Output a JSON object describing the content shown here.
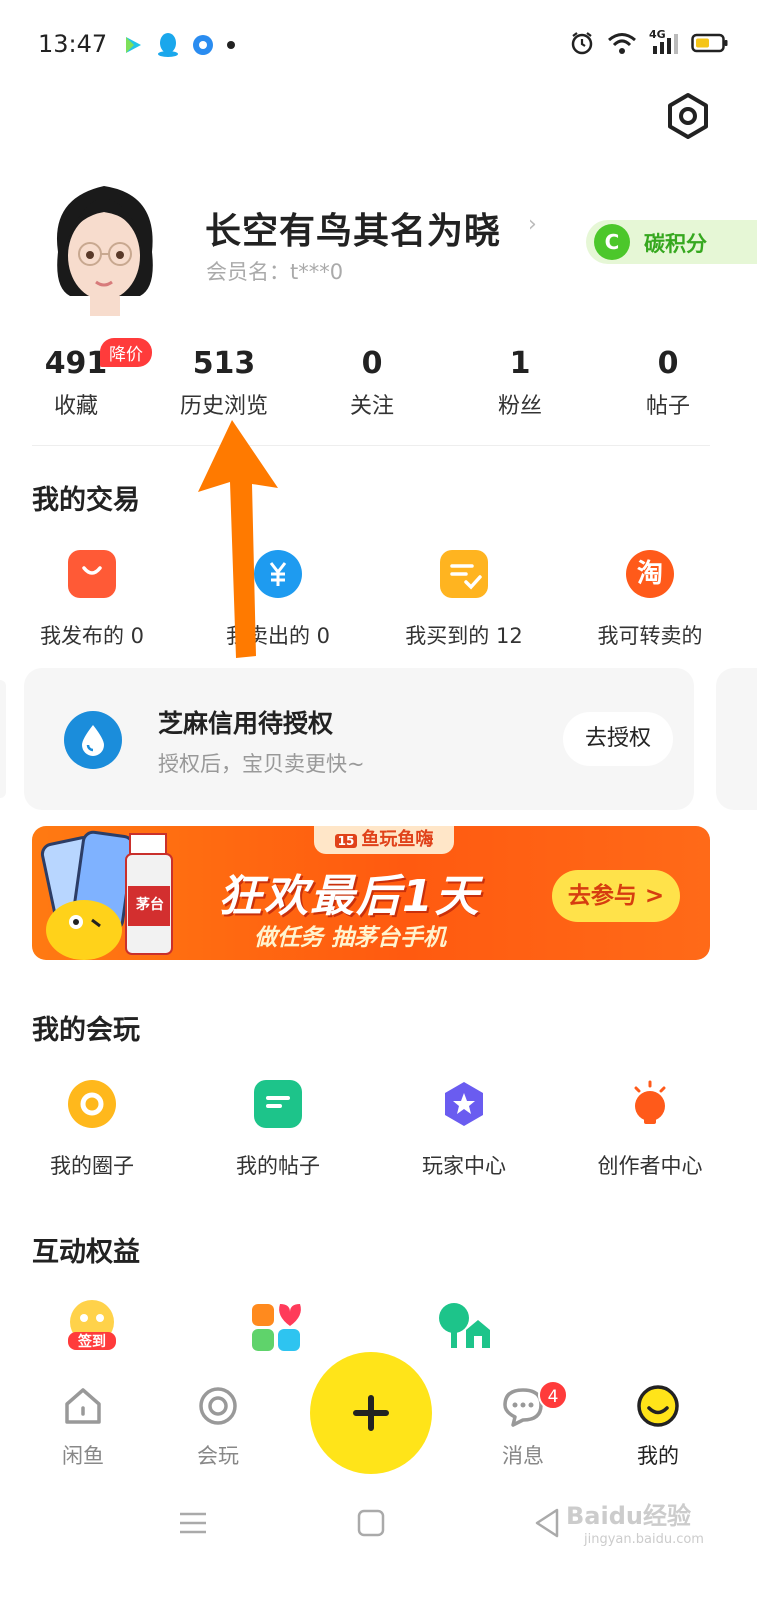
{
  "status_bar": {
    "time": "13:47",
    "network": "4G",
    "icons": [
      "video-app-icon",
      "qq-icon",
      "browser-icon",
      "dot-icon",
      "alarm-icon",
      "wifi-icon",
      "signal-icon",
      "battery-icon"
    ]
  },
  "profile": {
    "nickname": "长空有鸟其名为晓",
    "member_name": "会员名：t***0",
    "carbon_badge_letter": "C",
    "carbon_badge_label": "碳积分"
  },
  "stats": [
    {
      "value": "491",
      "label": "收藏",
      "badge": "降价"
    },
    {
      "value": "513",
      "label": "历史浏览"
    },
    {
      "value": "0",
      "label": "关注"
    },
    {
      "value": "1",
      "label": "粉丝"
    },
    {
      "value": "0",
      "label": "帖子"
    }
  ],
  "trade": {
    "title": "我的交易",
    "items": [
      {
        "label": "我发布的 0",
        "icon": "shopping-bag-icon",
        "color": "#ff5a36"
      },
      {
        "label": "我卖出的 0",
        "icon": "yuan-icon",
        "color": "#1e9bf0"
      },
      {
        "label": "我买到的 12",
        "icon": "order-check-icon",
        "color": "#ffb420"
      },
      {
        "label": "我可转卖的",
        "icon": "taobao-icon",
        "color": "#ff5a1a"
      }
    ]
  },
  "sesame": {
    "title": "芝麻信用待授权",
    "subtitle": "授权后，宝贝卖更快~",
    "button": "去授权"
  },
  "banner": {
    "tag": "鱼玩鱼嗨",
    "tag_num": "15",
    "title": "狂欢最后1天",
    "subtitle": "做任务 抽茅台手机",
    "button": "去参与 >",
    "bottle_text": "茅台"
  },
  "play": {
    "title": "我的会玩",
    "items": [
      {
        "label": "我的圈子",
        "icon": "circle-icon",
        "color": "#ffb81c"
      },
      {
        "label": "我的帖子",
        "icon": "post-icon",
        "color": "#1dc48a"
      },
      {
        "label": "玩家中心",
        "icon": "star-badge-icon",
        "color": "#6a5cf0"
      },
      {
        "label": "创作者中心",
        "icon": "bulb-icon",
        "color": "#ff5a1a"
      }
    ]
  },
  "rights": {
    "title": "互动权益",
    "checkin_label": "签到",
    "icons": [
      "checkin-icon",
      "puzzle-icon",
      "tree-house-icon"
    ]
  },
  "bottom_nav": {
    "items": [
      {
        "label": "闲鱼",
        "icon": "home-icon"
      },
      {
        "label": "会玩",
        "icon": "ring-icon"
      },
      {
        "label": "消息",
        "icon": "chat-icon",
        "badge": "4"
      },
      {
        "label": "我的",
        "icon": "smile-icon",
        "active": true
      }
    ],
    "publish_icon": "plus-icon"
  },
  "watermark": {
    "text": "Baidu经验",
    "sub": "jingyan.baidu.com"
  }
}
